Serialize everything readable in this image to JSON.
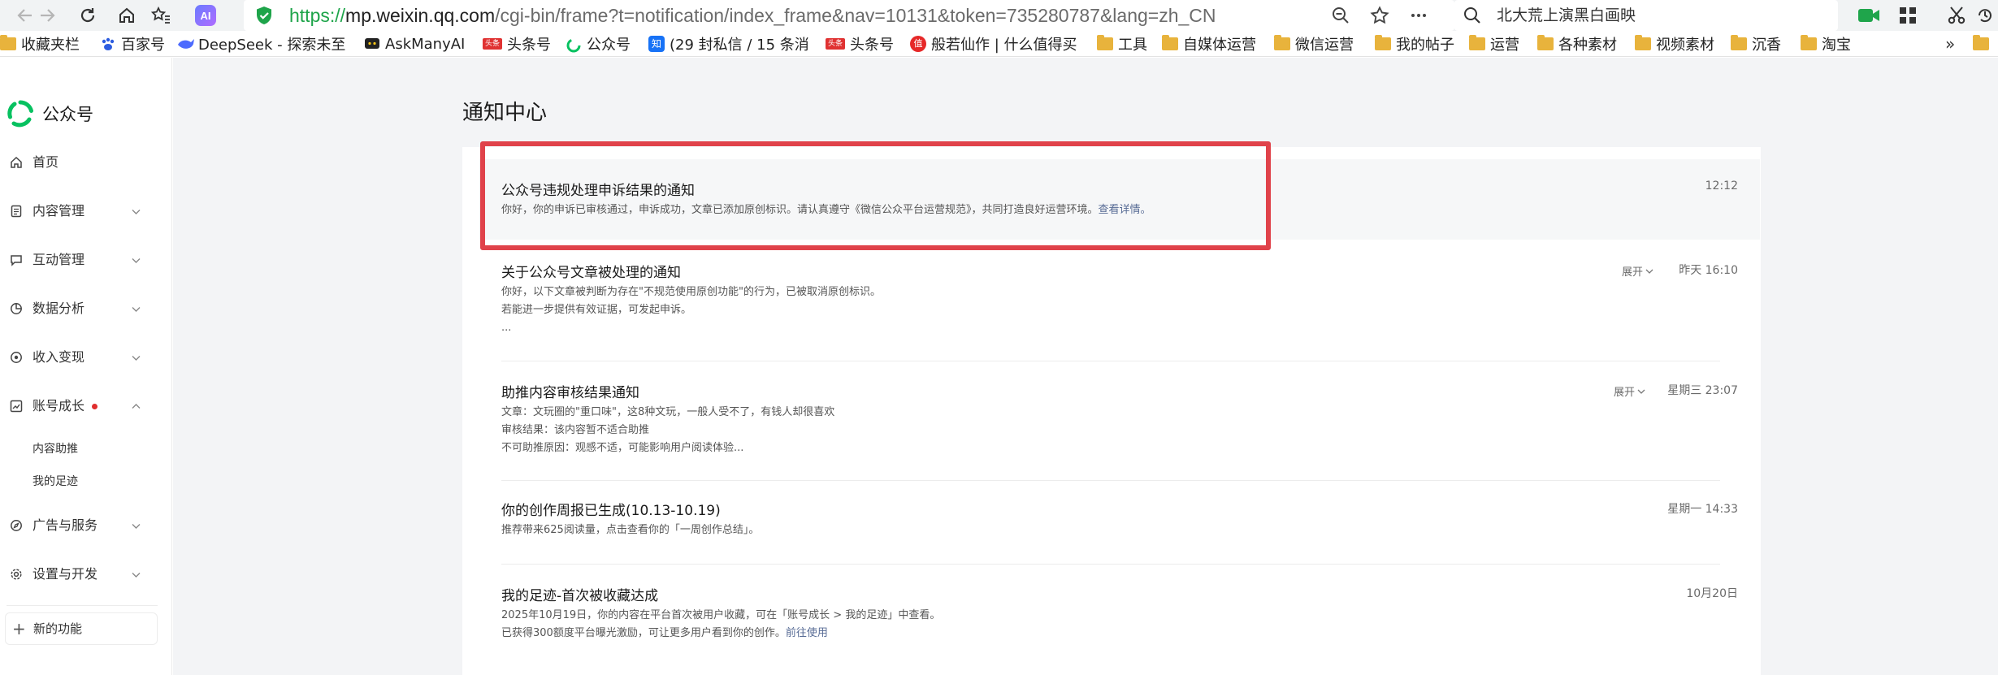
{
  "browser": {
    "url_scheme": "https://",
    "url_host": "mp.weixin.qq.com",
    "url_path": "/cgi-bin/frame?t=notification/index_frame&nav=10131&token=735280787&lang=zh_CN",
    "search_text": "北大荒上演黑白画映",
    "ext_label": "AI"
  },
  "bookmarks": [
    {
      "label": "收藏夹栏"
    },
    {
      "label": "百家号"
    },
    {
      "label": "DeepSeek - 探索未至"
    },
    {
      "label": "AskManyAI"
    },
    {
      "label": "头条号"
    },
    {
      "label": "公众号"
    },
    {
      "label": "(29 封私信 / 15 条消"
    },
    {
      "label": "头条号"
    },
    {
      "label": "般若仙作 | 什么值得买"
    },
    {
      "label": "工具"
    },
    {
      "label": "自媒体运营"
    },
    {
      "label": "微信运营"
    },
    {
      "label": "我的帖子"
    },
    {
      "label": "运营"
    },
    {
      "label": "各种素材"
    },
    {
      "label": "视频素材"
    },
    {
      "label": "沉香"
    },
    {
      "label": "淘宝"
    }
  ],
  "bookmark_badges": {
    "toutiao": "头条",
    "zhihu": "知",
    "smzdm": "值"
  },
  "bookmarks_more": "»",
  "sidebar": {
    "brand": "公众号",
    "items": [
      {
        "label": "首页"
      },
      {
        "label": "内容管理"
      },
      {
        "label": "互动管理"
      },
      {
        "label": "数据分析"
      },
      {
        "label": "收入变现"
      },
      {
        "label": "账号成长"
      },
      {
        "label": "广告与服务"
      },
      {
        "label": "设置与开发"
      }
    ],
    "sub_items": [
      {
        "label": "内容助推"
      },
      {
        "label": "我的足迹"
      }
    ],
    "new_feature": "新的功能",
    "new_feature_icon": "+"
  },
  "main": {
    "title": "通知中心",
    "notifications": [
      {
        "title": "公众号违规处理申诉结果的通知",
        "lines": [
          "你好，你的申诉已审核通过，申诉成功，文章已添加原创标识。请认真遵守《微信公众平台运营规范》，共同打造良好运营环境。"
        ],
        "link": "查看详情。",
        "time": "12:12"
      },
      {
        "title": "关于公众号文章被处理的通知",
        "lines": [
          "你好，以下文章被判断为存在\"不规范使用原创功能\"的行为，已被取消原创标识。",
          "若能进一步提供有效证据，可发起申诉。",
          "..."
        ],
        "expand": "展开",
        "time": "昨天 16:10"
      },
      {
        "title": "助推内容审核结果通知",
        "lines": [
          "文章：文玩圈的\"重口味\"，这8种文玩，一般人受不了，有钱人却很喜欢",
          "审核结果：该内容暂不适合助推",
          "不可助推原因：观感不适，可能影响用户阅读体验..."
        ],
        "expand": "展开",
        "time": "星期三 23:07"
      },
      {
        "title": "你的创作周报已生成(10.13-10.19)",
        "lines": [
          "推荐带来625阅读量，点击查看你的「一周创作总结」。"
        ],
        "time": "星期一 14:33"
      },
      {
        "title": "我的足迹-首次被收藏达成",
        "lines": [
          "2025年10月19日，你的内容在平台首次被用户收藏，可在「账号成长 > 我的足迹」中查看。",
          "已获得300额度平台曝光激励，可让更多用户看到你的创作。"
        ],
        "link": "前往使用",
        "time": "10月20日"
      }
    ]
  },
  "colors": {
    "brand_green": "#07c160",
    "link": "#576b95",
    "highlight_border": "#e0424a"
  }
}
